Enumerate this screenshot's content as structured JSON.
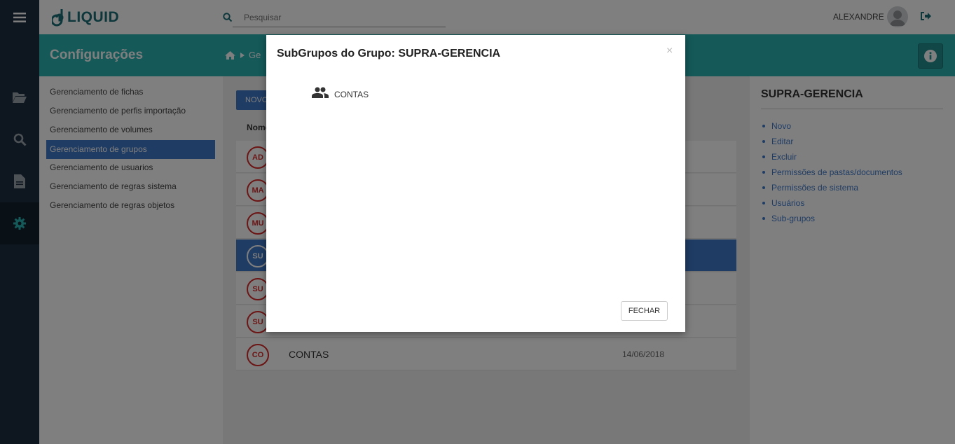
{
  "app": {
    "logo_text": "LIQUID"
  },
  "search": {
    "placeholder": "Pesquisar"
  },
  "user": {
    "name": "ALEXANDRE"
  },
  "header": {
    "title": "Configurações",
    "breadcrumb_partial": "Ge"
  },
  "submenu": {
    "items": [
      {
        "label": "Gerenciamento de fichas"
      },
      {
        "label": "Gerenciamento de perfis importação"
      },
      {
        "label": "Gerenciamento de volumes"
      },
      {
        "label": "Gerenciamento de grupos",
        "active": true
      },
      {
        "label": "Gerenciamento de usuarios"
      },
      {
        "label": "Gerenciamento de regras sistema"
      },
      {
        "label": "Gerenciamento de regras objetos"
      }
    ]
  },
  "content": {
    "new_button_label": "NOVO",
    "column_name": "Nome",
    "rows": [
      {
        "initials": "AD",
        "name": "",
        "date": ""
      },
      {
        "initials": "MA",
        "name": "",
        "date": ""
      },
      {
        "initials": "MU",
        "name": "",
        "date": ""
      },
      {
        "initials": "SU",
        "name": "",
        "date": "",
        "selected": true
      },
      {
        "initials": "SU",
        "name": "",
        "date": ""
      },
      {
        "initials": "SU",
        "name": "",
        "date": ""
      },
      {
        "initials": "CO",
        "name": "CONTAS",
        "date": "14/06/2018"
      }
    ]
  },
  "right_panel": {
    "title": "SUPRA-GERENCIA",
    "links": [
      {
        "label": "Novo"
      },
      {
        "label": "Editar"
      },
      {
        "label": "Excluir"
      },
      {
        "label": "Permissões de pastas/documentos"
      },
      {
        "label": "Permissões de sistema"
      },
      {
        "label": "Usuários"
      },
      {
        "label": "Sub-grupos"
      }
    ]
  },
  "modal": {
    "title": "SubGrupos do Grupo: SUPRA-GERENCIA",
    "close_symbol": "×",
    "subgroups": [
      {
        "label": "CONTAS"
      }
    ],
    "close_button_label": "FECHAR"
  },
  "colors": {
    "teal": "#2ab3b3",
    "dark_nav": "#1c2d3e",
    "accent_blue": "#3f78c8",
    "badge_red": "#d62a2a"
  }
}
